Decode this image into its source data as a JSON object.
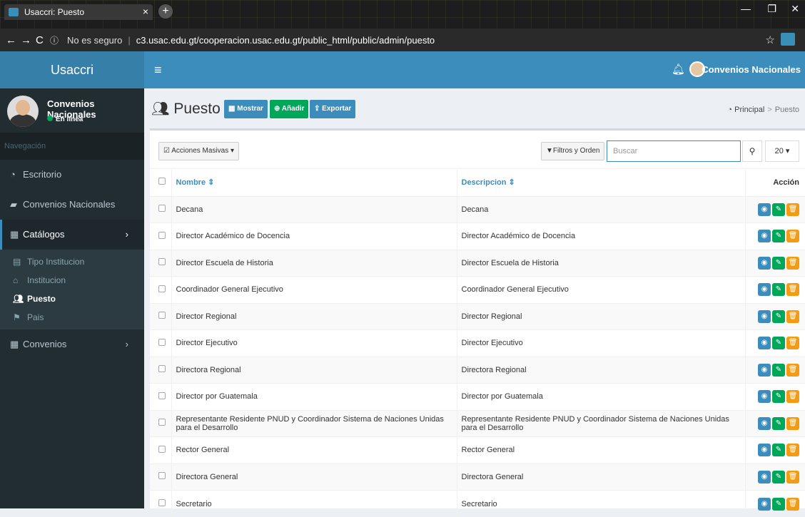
{
  "browser": {
    "tab_title": "Usaccri: Puesto",
    "security": "No es seguro",
    "url": "c3.usac.edu.gt/cooperacion.usac.edu.gt/public_html/public/admin/puesto"
  },
  "header": {
    "logo": "Usaccri",
    "user_name": "Convenios Nacionales"
  },
  "sidebar": {
    "user_title": "Convenios Nacionales",
    "user_status": "En línea",
    "nav_header": "Navegación",
    "items": [
      {
        "label": "Escritorio"
      },
      {
        "label": "Convenios Nacionales"
      },
      {
        "label": "Catálogos"
      },
      {
        "label": "Convenios"
      }
    ],
    "submenu": [
      {
        "label": "Tipo Institucion"
      },
      {
        "label": "Institucion"
      },
      {
        "label": "Puesto"
      },
      {
        "label": "Pais"
      }
    ]
  },
  "content": {
    "title": "Puesto",
    "buttons": {
      "mostrar": "Mostrar",
      "anadir": "Añadir",
      "exportar": "Exportar"
    },
    "breadcrumb": {
      "home": "Principal",
      "current": "Puesto"
    }
  },
  "toolbar": {
    "acciones": "Acciones Masivas",
    "filtros": "Filtros y Orden",
    "search_placeholder": "Buscar",
    "per_page": "20"
  },
  "table": {
    "headers": {
      "nombre": "Nombre",
      "descripcion": "Descripcion",
      "accion": "Acción"
    },
    "rows": [
      {
        "nombre": "Decana",
        "descripcion": "Decana"
      },
      {
        "nombre": "Director Académico de Docencia",
        "descripcion": "Director Académico de Docencia"
      },
      {
        "nombre": "Director Escuela de Historia",
        "descripcion": "Director Escuela de Historia"
      },
      {
        "nombre": "Coordinador General Ejecutivo",
        "descripcion": "Coordinador General Ejecutivo"
      },
      {
        "nombre": "Director Regional",
        "descripcion": "Director Regional"
      },
      {
        "nombre": "Director Ejecutivo",
        "descripcion": "Director Ejecutivo"
      },
      {
        "nombre": "Directora Regional",
        "descripcion": "Directora Regional"
      },
      {
        "nombre": "Director por Guatemala",
        "descripcion": "Director por Guatemala"
      },
      {
        "nombre": "Representante Residente PNUD y Coordinador Sistema de Naciones Unidas para el Desarrollo",
        "descripcion": "Representante Residente PNUD y Coordinador Sistema de Naciones Unidas para el Desarrollo"
      },
      {
        "nombre": "Rector General",
        "descripcion": "Rector General"
      },
      {
        "nombre": "Directora General",
        "descripcion": "Directora General"
      },
      {
        "nombre": "Secretario",
        "descripcion": "Secretario"
      }
    ]
  },
  "colors": {
    "primary": "#3c8dbc",
    "success": "#00a65a",
    "warning": "#f39c12",
    "sidebar": "#222d32"
  }
}
